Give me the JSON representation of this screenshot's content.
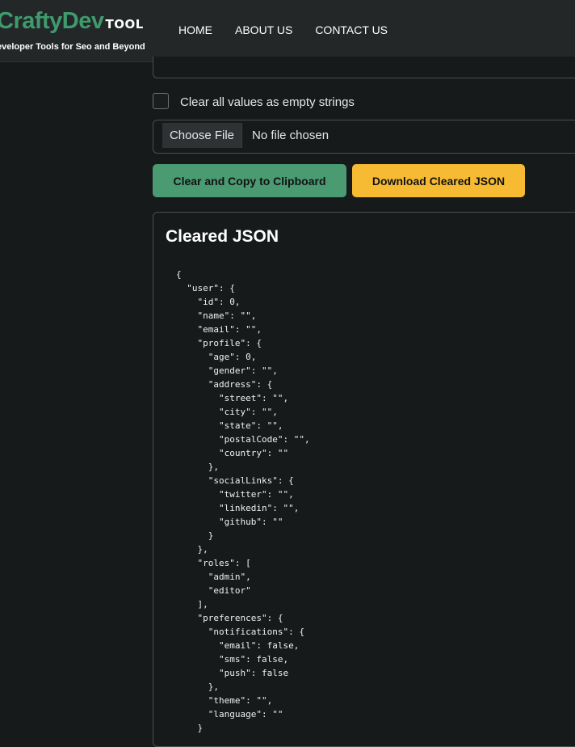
{
  "header": {
    "logo_main": "CraftyDev",
    "logo_suffix": "TOOL",
    "tagline": "eveloper Tools for Seo and Beyond",
    "nav": [
      "HOME",
      "ABOUT US",
      "CONTACT US"
    ]
  },
  "options": {
    "clear_empty_strings_label": "Clear all values as empty strings",
    "clear_empty_strings_checked": false
  },
  "file_input": {
    "button_label": "Choose File",
    "status": "No file chosen"
  },
  "actions": {
    "copy_label": "Clear and Copy to Clipboard",
    "download_label": "Download Cleared JSON"
  },
  "output": {
    "title": "Cleared JSON",
    "code": "{\n  \"user\": {\n    \"id\": 0,\n    \"name\": \"\",\n    \"email\": \"\",\n    \"profile\": {\n      \"age\": 0,\n      \"gender\": \"\",\n      \"address\": {\n        \"street\": \"\",\n        \"city\": \"\",\n        \"state\": \"\",\n        \"postalCode\": \"\",\n        \"country\": \"\"\n      },\n      \"socialLinks\": {\n        \"twitter\": \"\",\n        \"linkedin\": \"\",\n        \"github\": \"\"\n      }\n    },\n    \"roles\": [\n      \"admin\",\n      \"editor\"\n    ],\n    \"preferences\": {\n      \"notifications\": {\n        \"email\": false,\n        \"sms\": false,\n        \"push\": false\n      },\n      \"theme\": \"\",\n      \"language\": \"\"\n    }"
  },
  "colors": {
    "brand_green": "#3f9a6e",
    "copy_button": "#4a9a72",
    "download_button": "#f7bb33",
    "background": "#171a1b",
    "header": "#232728"
  }
}
